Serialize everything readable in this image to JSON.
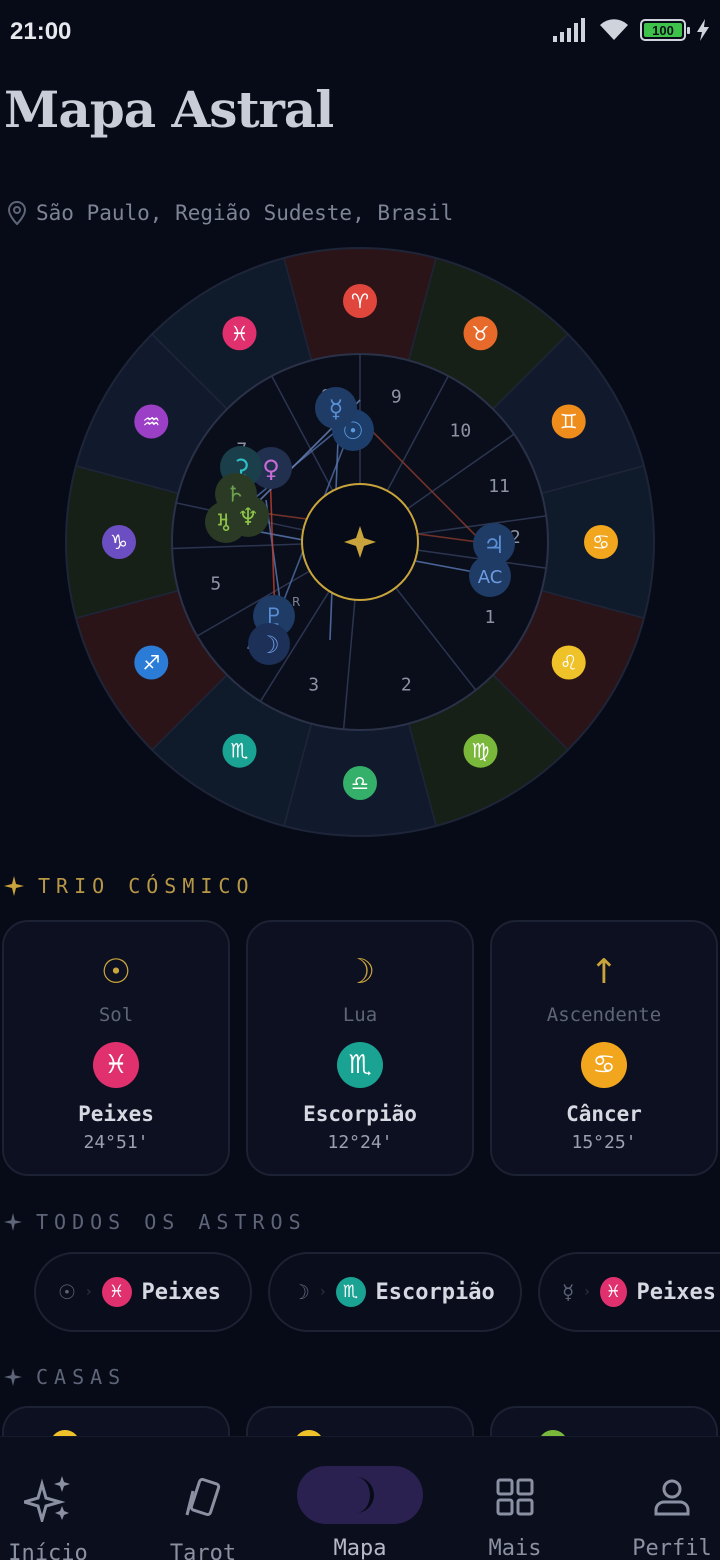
{
  "status_bar": {
    "time": "21:00",
    "battery": "100"
  },
  "page_title": "Mapa Astral",
  "location": "São Paulo, Região Sudeste, Brasil",
  "colors": {
    "gold": "#c9a43c",
    "fire": "#e0463c",
    "earth": "#79b83a",
    "air": "#8b3fbf",
    "water": "#e0306e"
  },
  "chart": {
    "center_icon": "star-icon",
    "houses": [
      {
        "num": "1"
      },
      {
        "num": "2"
      },
      {
        "num": "3"
      },
      {
        "num": "4"
      },
      {
        "num": "5"
      },
      {
        "num": "6"
      },
      {
        "num": "7"
      },
      {
        "num": "8"
      },
      {
        "num": "9"
      },
      {
        "num": "10"
      },
      {
        "num": "11"
      },
      {
        "num": "12"
      }
    ],
    "signs": [
      {
        "name": "aries",
        "glyph": "♈",
        "color": "#e0463c"
      },
      {
        "name": "taurus",
        "glyph": "♉",
        "color": "#e86a2a"
      },
      {
        "name": "gemini",
        "glyph": "♊",
        "color": "#ee8c1c"
      },
      {
        "name": "cancer",
        "glyph": "♋",
        "color": "#f2a61e"
      },
      {
        "name": "leo",
        "glyph": "♌",
        "color": "#f0c22a"
      },
      {
        "name": "virgo",
        "glyph": "♍",
        "color": "#79b83a"
      },
      {
        "name": "libra",
        "glyph": "♎",
        "color": "#35b06a"
      },
      {
        "name": "scorpio",
        "glyph": "♏",
        "color": "#1aa392"
      },
      {
        "name": "sagittarius",
        "glyph": "♐",
        "color": "#2a7cd6"
      },
      {
        "name": "capricorn",
        "glyph": "♑",
        "color": "#6b4fc2"
      },
      {
        "name": "aquarius",
        "glyph": "♒",
        "color": "#9b3fc7"
      },
      {
        "name": "pisces",
        "glyph": "♓",
        "color": "#e0306e"
      }
    ],
    "planets": [
      {
        "name": "sun",
        "glyph": "☉"
      },
      {
        "name": "mercury",
        "glyph": "☿"
      },
      {
        "name": "venus",
        "glyph": "♀"
      },
      {
        "name": "ceres",
        "glyph": "⚳"
      },
      {
        "name": "saturn",
        "glyph": "♄"
      },
      {
        "name": "uranus",
        "glyph": "♅"
      },
      {
        "name": "neptune",
        "glyph": "♆"
      },
      {
        "name": "pluto",
        "glyph": "♇"
      },
      {
        "name": "moon",
        "glyph": "☽"
      },
      {
        "name": "jupiter",
        "glyph": "♃"
      },
      {
        "name": "ascendant",
        "glyph": "AC"
      }
    ],
    "retrograde_mark": "R"
  },
  "trio": {
    "title": "TRIO CÓSMICO",
    "cards": [
      {
        "glyph": "☉",
        "name": "Sol",
        "sign_glyph": "♓",
        "sign": "Peixes",
        "degree": "24°51'",
        "color": "#e0306e"
      },
      {
        "glyph": "☽",
        "name": "Lua",
        "sign_glyph": "♏",
        "sign": "Escorpião",
        "degree": "12°24'",
        "color": "#1aa392"
      },
      {
        "glyph": "↑",
        "name": "Ascendente",
        "sign_glyph": "♋",
        "sign": "Câncer",
        "degree": "15°25'",
        "color": "#f2a61e"
      }
    ]
  },
  "astros": {
    "title": "TODOS OS ASTROS",
    "items": [
      {
        "planet": "☉",
        "sep": "›",
        "sign_glyph": "♓",
        "sign": "Peixes",
        "color": "#e0306e"
      },
      {
        "planet": "☽",
        "sep": "›",
        "sign_glyph": "♏",
        "sign": "Escorpião",
        "color": "#1aa392"
      },
      {
        "planet": "☿",
        "sep": "›",
        "sign_glyph": "♓",
        "sign": "Peixes",
        "color": "#e0306e"
      }
    ]
  },
  "casas": {
    "title": "CASAS",
    "items": [
      {
        "sign_glyph": "♌",
        "color": "#f0c22a"
      },
      {
        "sign_glyph": "♌",
        "color": "#f0c22a"
      },
      {
        "sign_glyph": "♍",
        "color": "#79b83a"
      }
    ]
  },
  "nav": {
    "items": [
      {
        "label": "Início"
      },
      {
        "label": "Tarot"
      },
      {
        "label": "Mapa"
      },
      {
        "label": "Mais"
      },
      {
        "label": "Perfil"
      }
    ]
  }
}
